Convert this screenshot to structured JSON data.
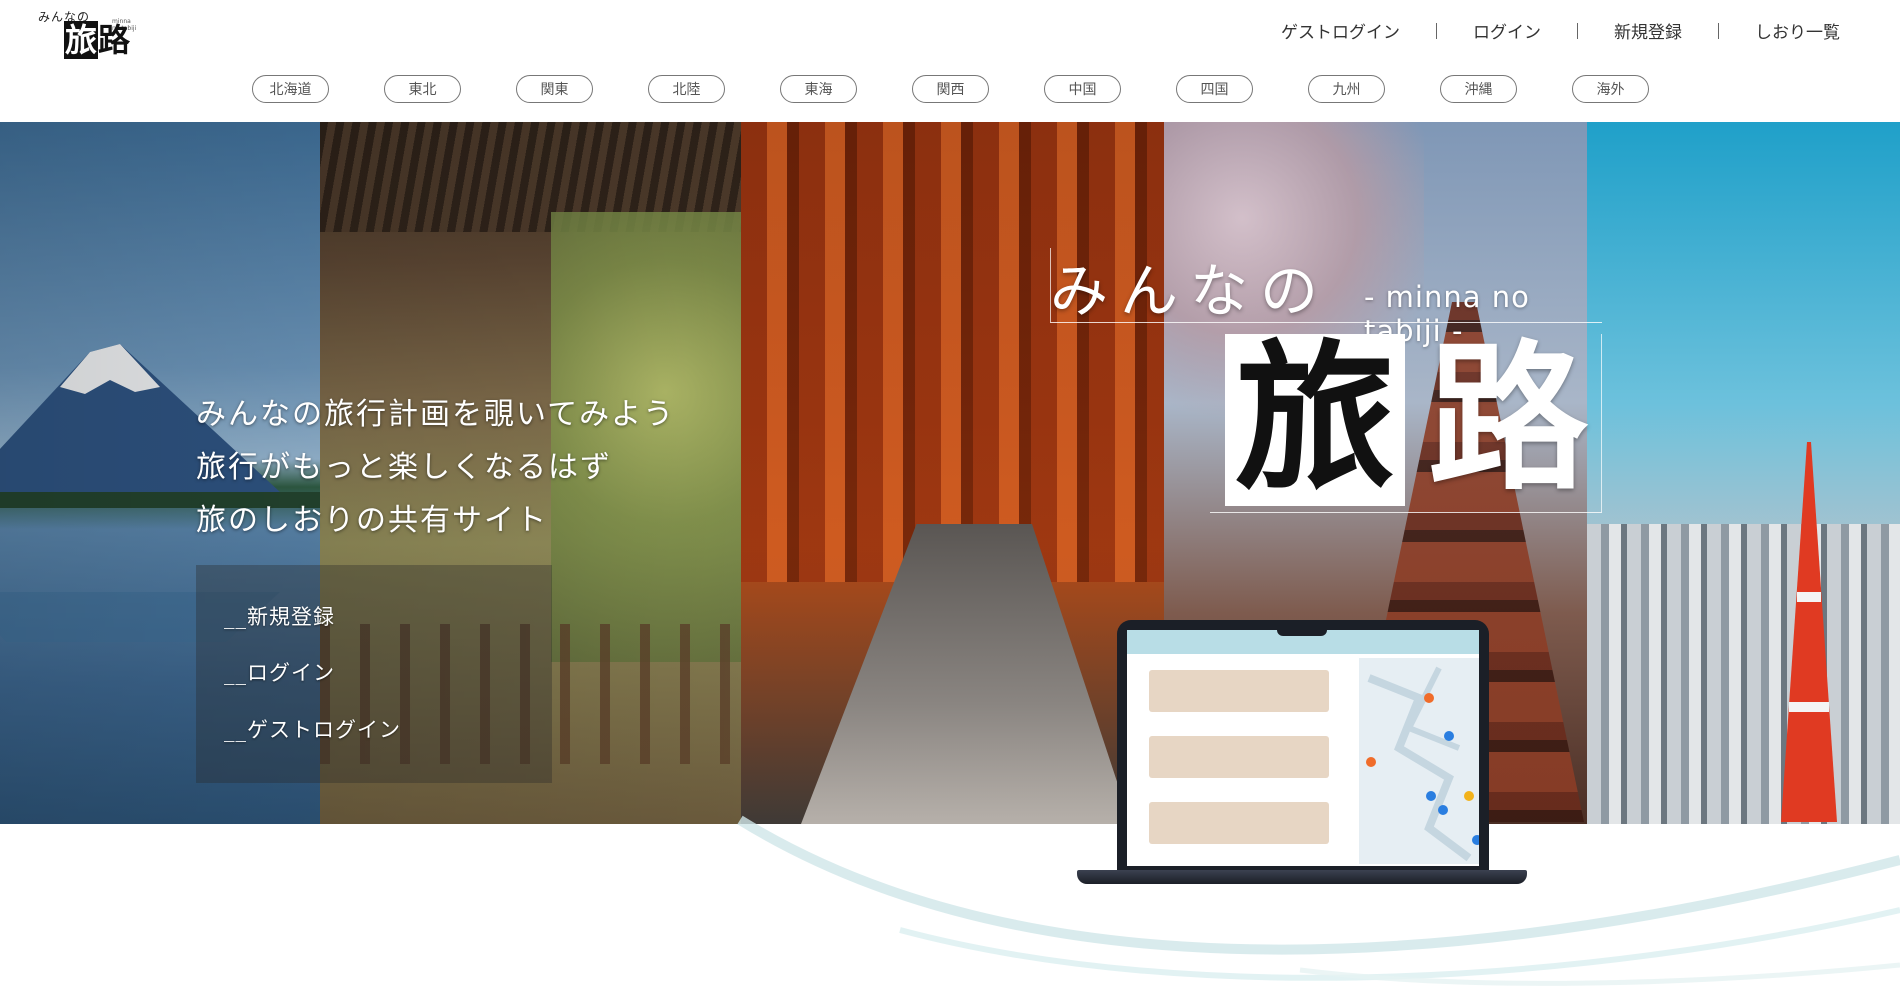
{
  "header": {
    "logo": {
      "small_text": "みんなの",
      "tiny_text": "minna no tabiji",
      "main_kanji_1": "旅",
      "main_kanji_2": "路"
    },
    "nav": [
      {
        "label": "ゲストログイン"
      },
      {
        "label": "ログイン"
      },
      {
        "label": "新規登録"
      },
      {
        "label": "しおり一覧"
      }
    ],
    "regions": [
      {
        "label": "北海道"
      },
      {
        "label": "東北"
      },
      {
        "label": "関東"
      },
      {
        "label": "北陸"
      },
      {
        "label": "東海"
      },
      {
        "label": "関西"
      },
      {
        "label": "中国"
      },
      {
        "label": "四国"
      },
      {
        "label": "九州"
      },
      {
        "label": "沖縄"
      },
      {
        "label": "海外"
      }
    ]
  },
  "hero": {
    "tagline": [
      "みんなの旅行計画を覗いてみよう",
      "旅行がもっと楽しくなるはず",
      "旅のしおりの共有サイト"
    ],
    "actions": [
      {
        "label": "__新規登録"
      },
      {
        "label": "__ログイン"
      },
      {
        "label": "__ゲストログイン"
      }
    ],
    "title": {
      "hiragana": "みんなの",
      "romaji": "- minna no tabiji -",
      "kanji_1": "旅",
      "kanji_2": "路"
    }
  },
  "colors": {
    "accent_sky": "#1fa0c9",
    "torii_orange": "#d35e22",
    "card_beige": "#e7d6c4",
    "wave_teal": "#cfe6e8"
  }
}
